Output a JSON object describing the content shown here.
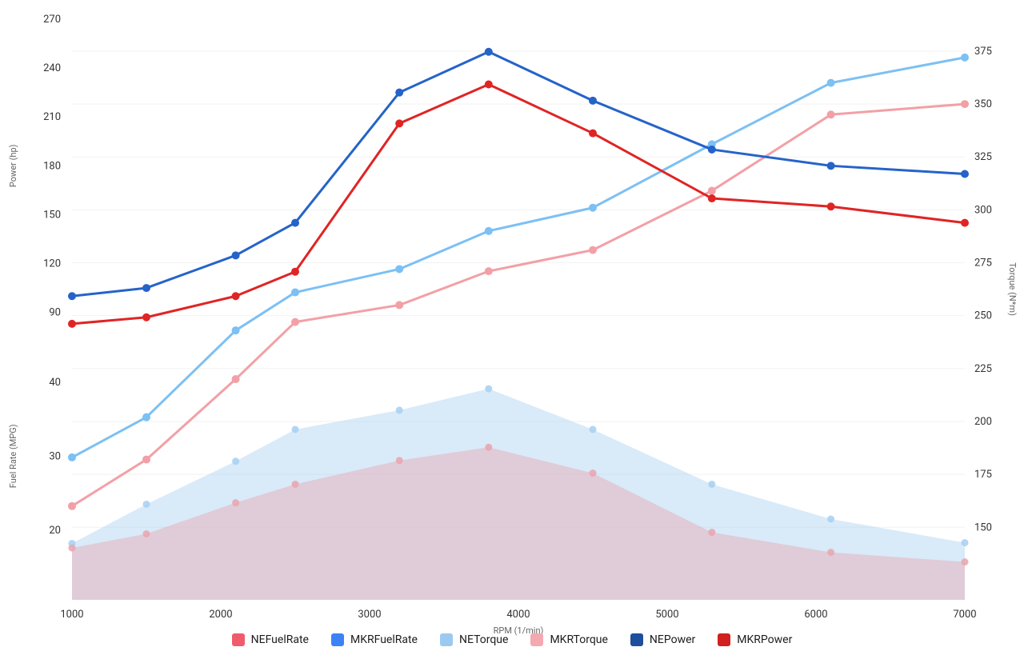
{
  "chart_data": {
    "type": "line",
    "x": [
      1000,
      1500,
      2100,
      2500,
      3200,
      3800,
      4500,
      5300,
      6100,
      7000
    ],
    "xlabel": "RPM (1/min)",
    "x_ticks": [
      1000,
      2000,
      3000,
      4000,
      5000,
      6000,
      7000
    ],
    "axes": {
      "power": {
        "label": "Power (hp)",
        "side": "left-upper",
        "ticks": [
          90,
          120,
          150,
          180,
          210,
          240,
          270
        ]
      },
      "fuel": {
        "label": "Fuel Rate (MPG)",
        "side": "left-lower",
        "ticks": [
          20,
          30,
          40
        ]
      },
      "torque": {
        "label": "Torque (N*m)",
        "side": "right",
        "ticks": [
          150,
          175,
          200,
          225,
          250,
          275,
          300,
          325,
          350,
          375
        ]
      }
    },
    "series": [
      {
        "name": "NEFuelRate",
        "axis": "fuel",
        "style": "area",
        "color": "#aad1f2",
        "values": [
          18.2,
          23.5,
          29.3,
          33.6,
          36.2,
          39.1,
          33.6,
          26.2,
          21.5,
          18.3
        ]
      },
      {
        "name": "MKRFuelRate",
        "axis": "fuel",
        "style": "area",
        "color": "#e9a7b0",
        "values": [
          17.6,
          19.5,
          23.7,
          26.2,
          29.4,
          31.2,
          27.7,
          19.7,
          17.0,
          15.7
        ]
      },
      {
        "name": "NETorque",
        "axis": "torque",
        "style": "line",
        "color": "#7cc0f4",
        "values": [
          183,
          202,
          243,
          261,
          272,
          290,
          301,
          331,
          360,
          372
        ]
      },
      {
        "name": "MKRTorque",
        "axis": "torque",
        "style": "line",
        "color": "#f2a0a6",
        "values": [
          160,
          182,
          220,
          247,
          255,
          271,
          281,
          309,
          345,
          350
        ]
      },
      {
        "name": "NEPower",
        "axis": "power",
        "style": "line",
        "color": "#2563c9",
        "values": [
          100,
          105,
          125,
          145,
          225,
          250,
          220,
          190,
          180,
          175
        ]
      },
      {
        "name": "MKRPower",
        "axis": "power",
        "style": "line",
        "color": "#e02424",
        "values": [
          83,
          87,
          100,
          115,
          206,
          230,
          200,
          160,
          155,
          145
        ]
      }
    ],
    "legend_order": [
      "NEFuelRate",
      "MKRFuelRate",
      "NETorque",
      "MKRTorque",
      "NEPower",
      "MKRPower"
    ],
    "legend_colors": {
      "NEFuelRate": "#f05b6c",
      "MKRFuelRate": "#3b82f6",
      "NETorque": "#9cc9f0",
      "MKRTorque": "#f4a9b0",
      "NEPower": "#1e4e9c",
      "MKRPower": "#d21f1f"
    }
  }
}
